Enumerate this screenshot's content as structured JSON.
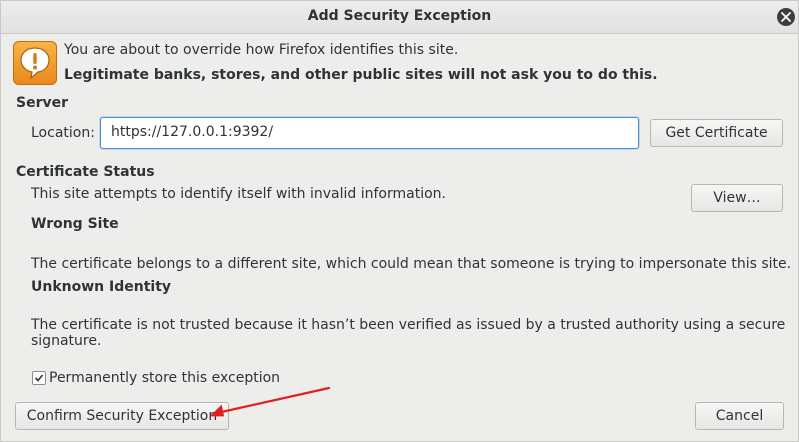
{
  "window": {
    "title": "Add Security Exception"
  },
  "intro": {
    "line1": "You are about to override how Firefox identifies this site.",
    "line2": "Legitimate banks, stores, and other public sites will not ask you to do this."
  },
  "server": {
    "heading": "Server",
    "location_label": "Location:",
    "location_value": "https://127.0.0.1:9392/",
    "get_certificate_label": "Get Certificate"
  },
  "certificate_status": {
    "heading": "Certificate Status",
    "summary": "This site attempts to identify itself with invalid information.",
    "view_label": "View…",
    "issues": [
      {
        "title": "Wrong Site",
        "description": "The certificate belongs to a different site, which could mean that someone is trying to impersonate this site."
      },
      {
        "title": "Unknown Identity",
        "description": "The certificate is not trusted because it hasn’t been verified as issued by a trusted authority using a secure signature."
      }
    ]
  },
  "permanent_store": {
    "label": "Permanently store this exception",
    "checked": true
  },
  "footer": {
    "confirm_label": "Confirm Security Exception",
    "cancel_label": "Cancel"
  },
  "colors": {
    "accent": "#4a90d9",
    "warning": "#f0a030",
    "annotation_arrow": "#e02020"
  }
}
